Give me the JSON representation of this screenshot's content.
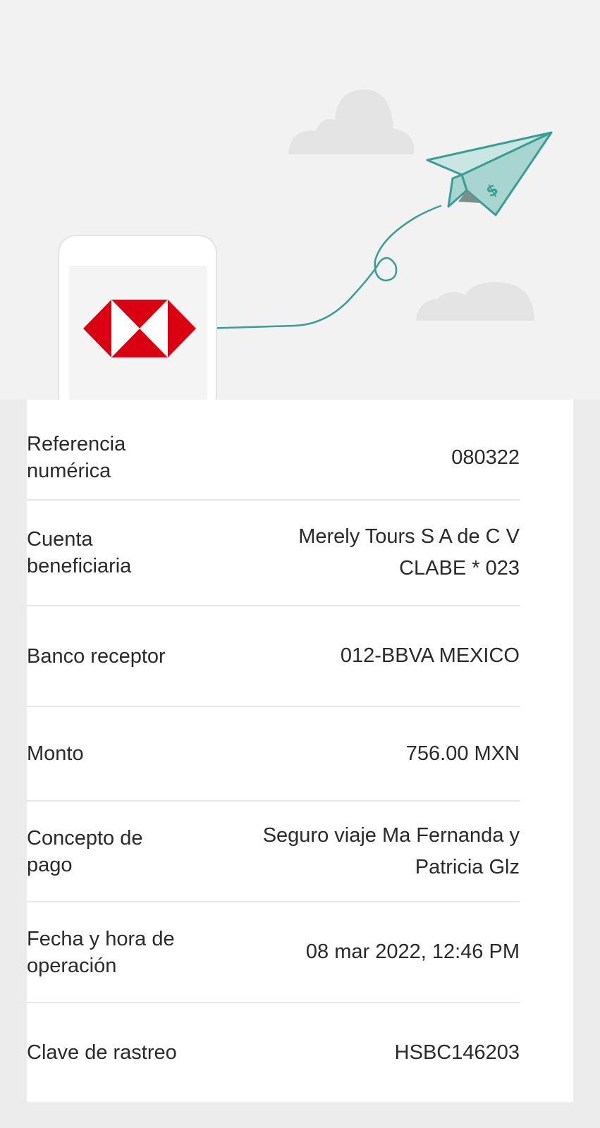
{
  "colors": {
    "brand_red": "#db0011",
    "plane_teal": "#3a9d96",
    "plane_fill": "#a8d5d0",
    "background": "#ececec",
    "card": "#ffffff"
  },
  "hero": {
    "illustration": "paper-plane-transfer",
    "logo": "hsbc-hexagon-logo",
    "plane_icon_glyph": "$"
  },
  "details": [
    {
      "label": "Referencia numérica",
      "value_lines": [
        "080322"
      ]
    },
    {
      "label": "Cuenta beneficiaria",
      "value_lines": [
        "Merely Tours S A de C V",
        "CLABE * 023"
      ]
    },
    {
      "label": "Banco receptor",
      "value_lines": [
        "012-BBVA MEXICO"
      ]
    },
    {
      "label": "Monto",
      "value_lines": [
        "756.00 MXN"
      ]
    },
    {
      "label": "Concepto de pago",
      "value_lines": [
        "Seguro viaje Ma Fernanda y",
        "Patricia Glz"
      ]
    },
    {
      "label": "Fecha y hora de operación",
      "value_lines": [
        "08 mar 2022, 12:46 PM"
      ]
    },
    {
      "label": "Clave de rastreo",
      "value_lines": [
        "HSBC146203"
      ]
    }
  ]
}
